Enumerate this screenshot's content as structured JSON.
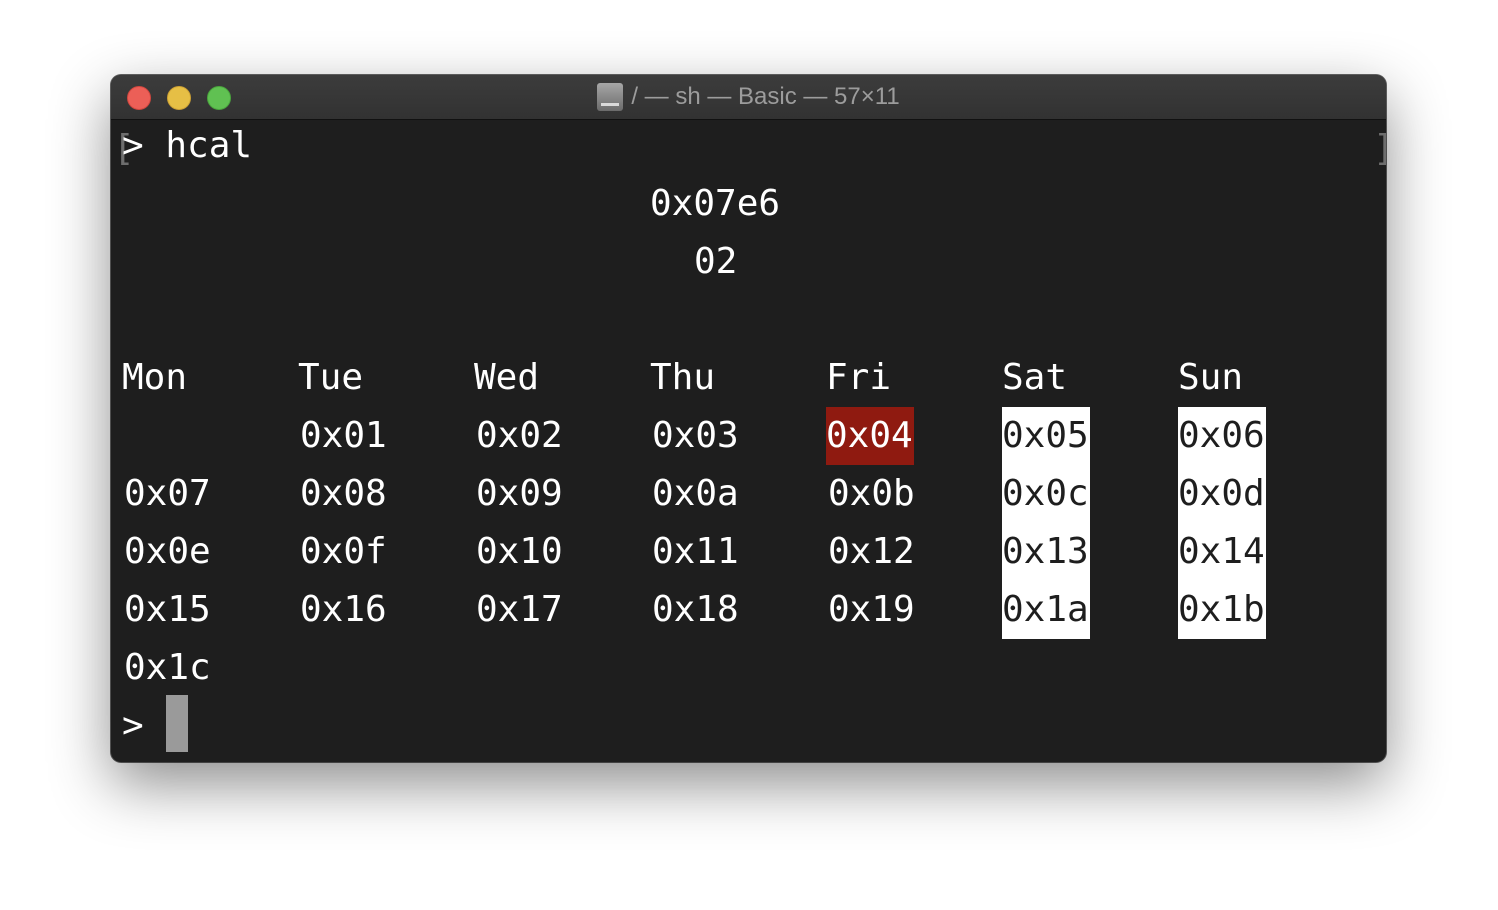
{
  "window": {
    "title": "/ — sh — Basic — 57×11"
  },
  "terminal": {
    "command_line": "> hcal",
    "year": "0x07e6",
    "month": "02",
    "weekdays": [
      "Mon",
      "Tue",
      "Wed",
      "Thu",
      "Fri",
      "Sat",
      "Sun"
    ],
    "weeks": [
      [
        "",
        "0x01",
        "0x02",
        "0x03",
        "0x04",
        "0x05",
        "0x06"
      ],
      [
        "0x07",
        "0x08",
        "0x09",
        "0x0a",
        "0x0b",
        "0x0c",
        "0x0d"
      ],
      [
        "0x0e",
        "0x0f",
        "0x10",
        "0x11",
        "0x12",
        "0x13",
        "0x14"
      ],
      [
        "0x15",
        "0x16",
        "0x17",
        "0x18",
        "0x19",
        "0x1a",
        "0x1b"
      ],
      [
        "0x1c",
        "",
        "",
        "",
        "",
        "",
        ""
      ]
    ],
    "today": "0x04",
    "prompt": ">",
    "left_bracket": "[",
    "right_bracket": "]"
  },
  "colors": {
    "background": "#1e1e1e",
    "foreground": "#ffffff",
    "today_highlight": "#8f1a10",
    "weekend_highlight": "#ffffff",
    "cursor": "#9a9a9a"
  }
}
